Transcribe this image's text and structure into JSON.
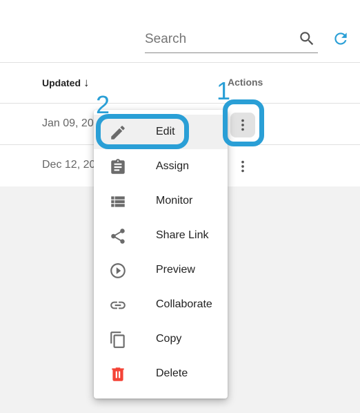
{
  "search": {
    "placeholder": "Search"
  },
  "table": {
    "columns": {
      "updated": "Updated",
      "actions": "Actions"
    },
    "rows": [
      {
        "date": "Jan 09, 20"
      },
      {
        "date": "Dec 12, 20"
      }
    ]
  },
  "annotations": {
    "step1": "1",
    "step2": "2",
    "highlight_color": "#2a9fd6"
  },
  "menu": {
    "items": [
      {
        "label": "Edit",
        "icon": "pencil-icon"
      },
      {
        "label": "Assign",
        "icon": "clipboard-icon"
      },
      {
        "label": "Monitor",
        "icon": "list-icon"
      },
      {
        "label": "Share Link",
        "icon": "share-icon"
      },
      {
        "label": "Preview",
        "icon": "play-circle-icon"
      },
      {
        "label": "Collaborate",
        "icon": "link-icon"
      },
      {
        "label": "Copy",
        "icon": "copy-icon"
      },
      {
        "label": "Delete",
        "icon": "trash-icon",
        "color": "#f44336"
      }
    ]
  },
  "colors": {
    "accent": "#2a9fd6",
    "icon_grey": "#6b6b6b",
    "delete": "#f44336"
  }
}
